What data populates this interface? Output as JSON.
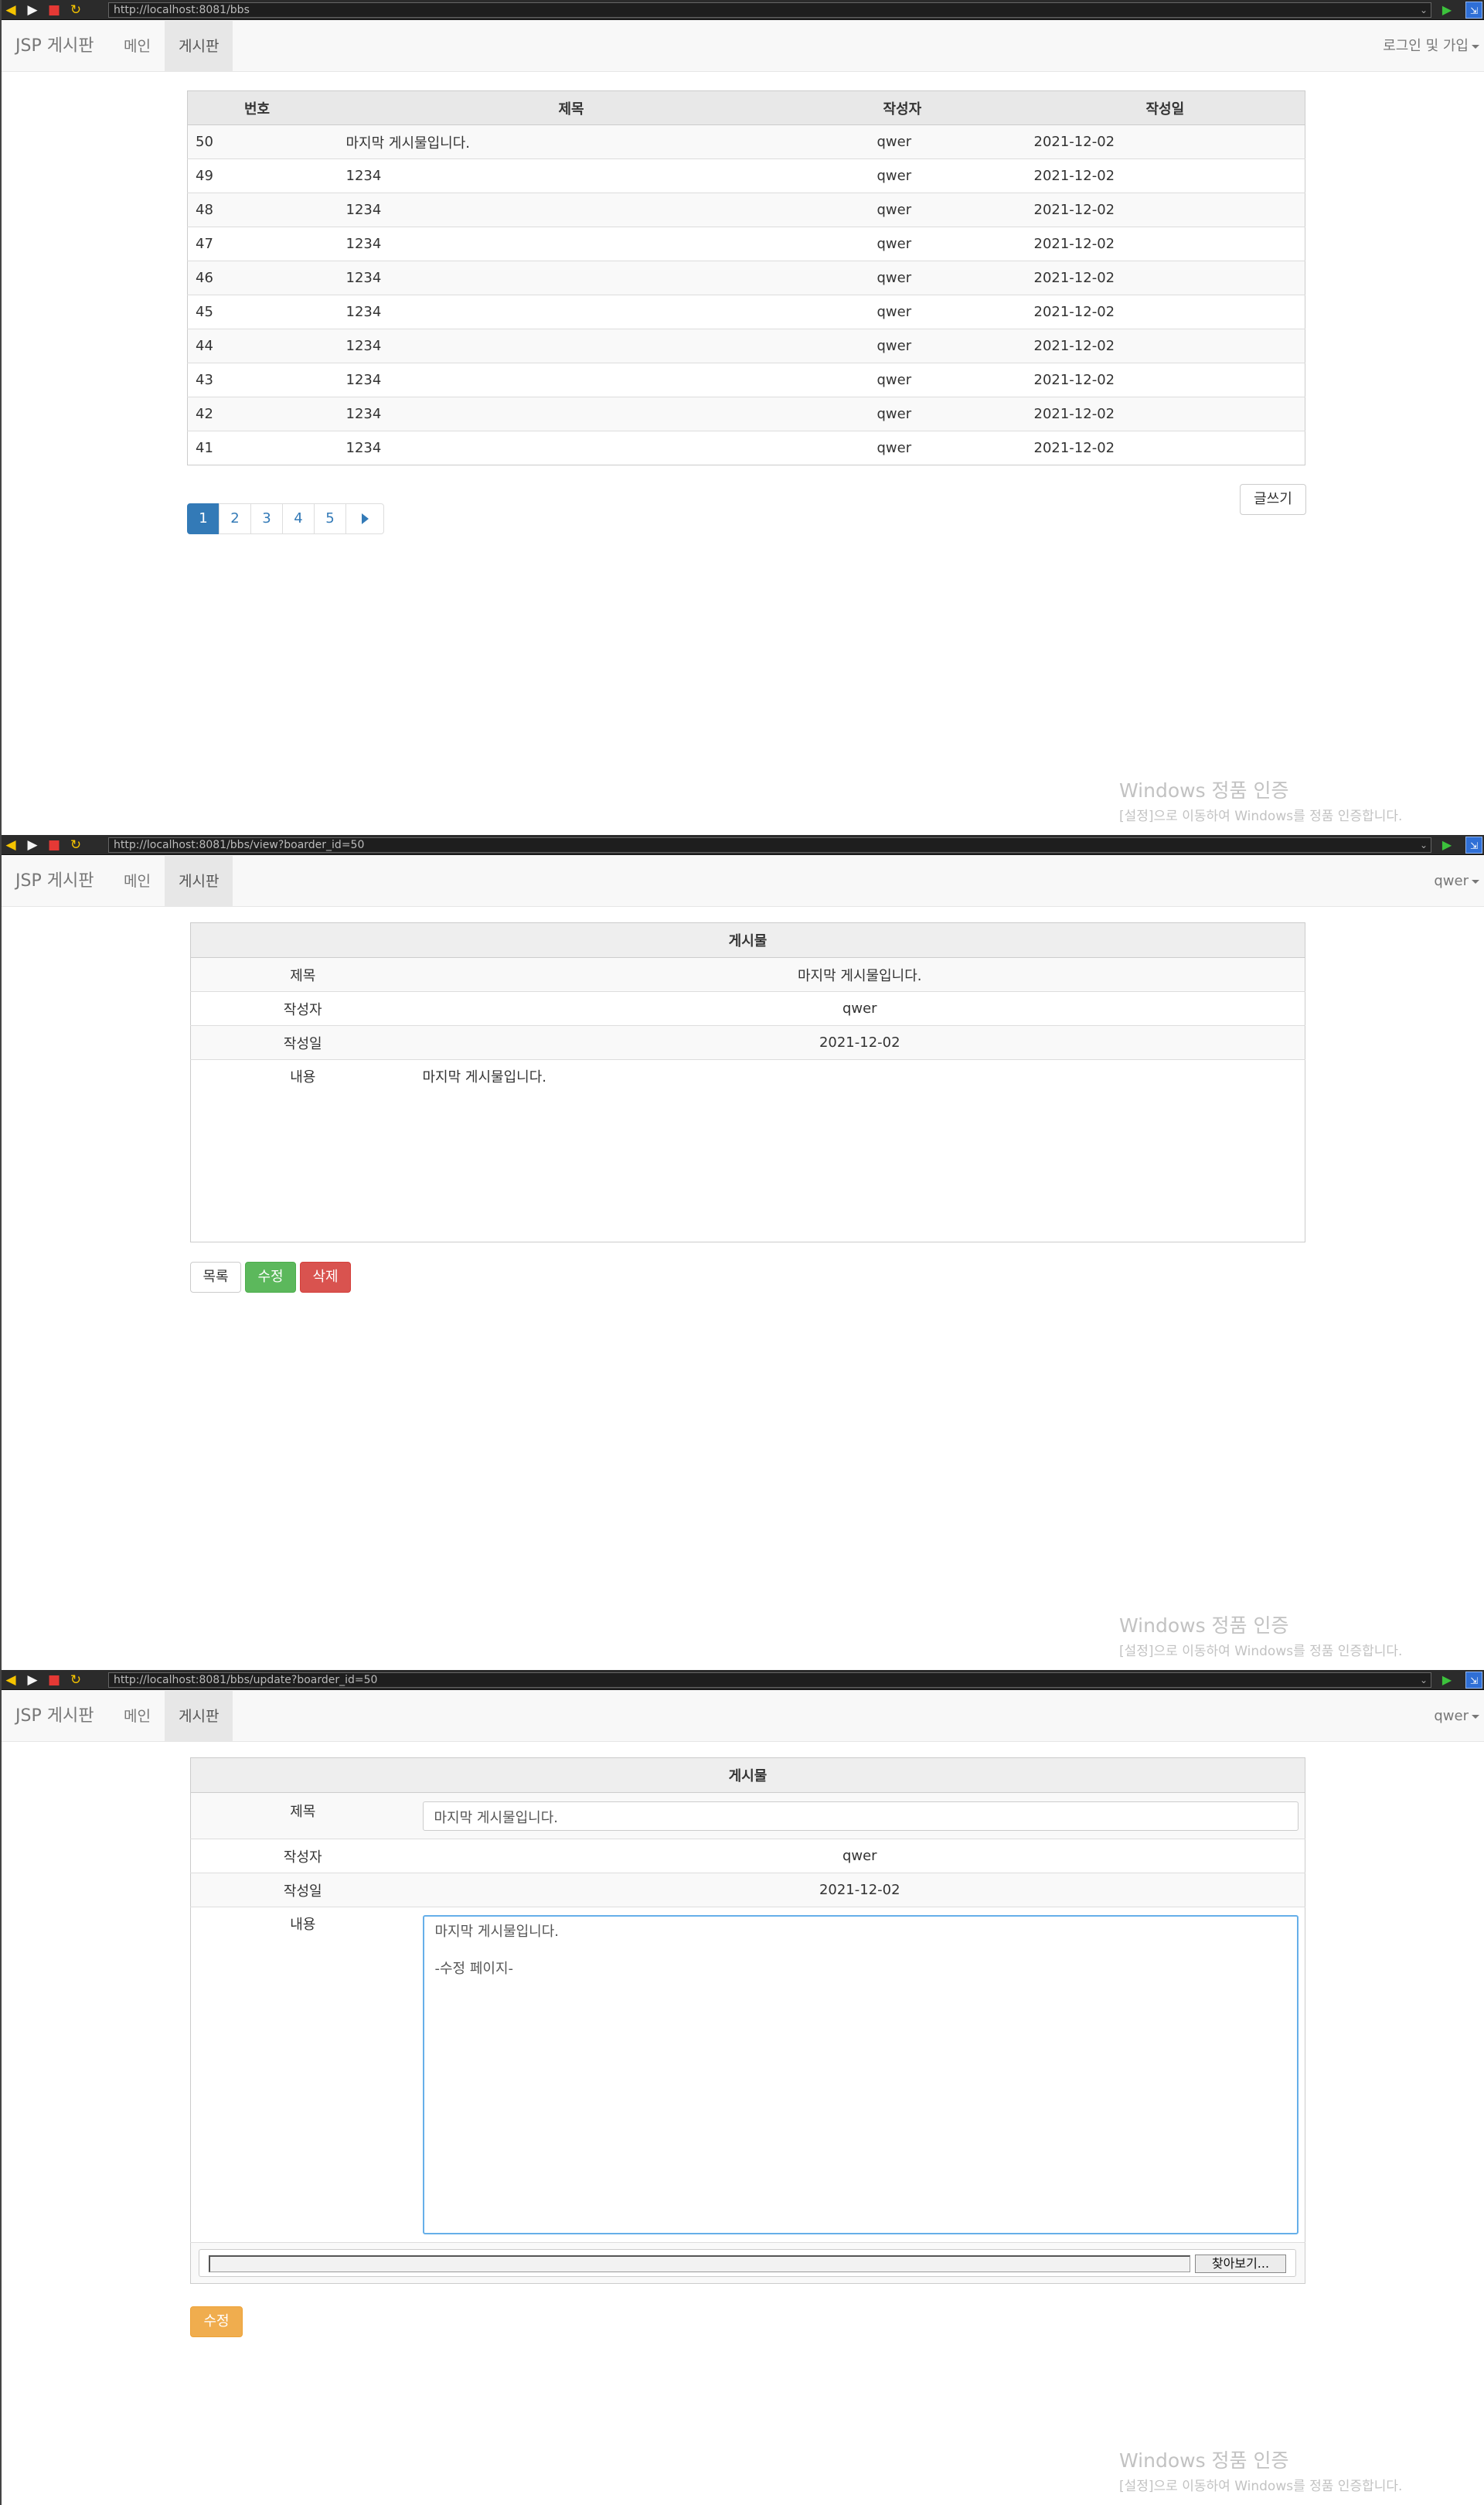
{
  "screen1": {
    "browser": {
      "url": "http://localhost:8081/bbs"
    },
    "navbar": {
      "brand": "JSP 게시판",
      "main": "메인",
      "bbs": "게시판",
      "right": "로그인 및 가입"
    },
    "table": {
      "headers": [
        "번호",
        "제목",
        "작성자",
        "작성일"
      ],
      "rows": [
        [
          "50",
          "마지막 게시물입니다.",
          "qwer",
          "2021-12-02"
        ],
        [
          "49",
          "1234",
          "qwer",
          "2021-12-02"
        ],
        [
          "48",
          "1234",
          "qwer",
          "2021-12-02"
        ],
        [
          "47",
          "1234",
          "qwer",
          "2021-12-02"
        ],
        [
          "46",
          "1234",
          "qwer",
          "2021-12-02"
        ],
        [
          "45",
          "1234",
          "qwer",
          "2021-12-02"
        ],
        [
          "44",
          "1234",
          "qwer",
          "2021-12-02"
        ],
        [
          "43",
          "1234",
          "qwer",
          "2021-12-02"
        ],
        [
          "42",
          "1234",
          "qwer",
          "2021-12-02"
        ],
        [
          "41",
          "1234",
          "qwer",
          "2021-12-02"
        ]
      ]
    },
    "pagination": {
      "pages": [
        "1",
        "2",
        "3",
        "4",
        "5"
      ],
      "active": "1",
      "next_icon": "chevron-right-icon"
    },
    "write_button": "글쓰기"
  },
  "screen2": {
    "browser": {
      "url": "http://localhost:8081/bbs/view?boarder_id=50"
    },
    "navbar": {
      "brand": "JSP 게시판",
      "main": "메인",
      "bbs": "게시판",
      "right": "qwer"
    },
    "table": {
      "header": "게시물",
      "title_label": "제목",
      "title_value": "마지막 게시물입니다.",
      "author_label": "작성자",
      "author_value": "qwer",
      "date_label": "작성일",
      "date_value": "2021-12-02",
      "content_label": "내용",
      "content_value": "마지막 게시물입니다."
    },
    "buttons": {
      "list": "목록",
      "edit": "수정",
      "delete": "삭제"
    }
  },
  "screen3": {
    "browser": {
      "url": "http://localhost:8081/bbs/update?boarder_id=50"
    },
    "navbar": {
      "brand": "JSP 게시판",
      "main": "메인",
      "bbs": "게시판",
      "right": "qwer"
    },
    "table": {
      "header": "게시물",
      "title_label": "제목",
      "title_value": "마지막 게시물입니다.",
      "author_label": "작성자",
      "author_value": "qwer",
      "date_label": "작성일",
      "date_value": "2021-12-02",
      "content_label": "내용",
      "content_value": "마지막 게시물입니다.\n\n-수정 페이지-"
    },
    "file_button": "찾아보기...",
    "submit_button": "수정"
  },
  "watermark": {
    "title": "Windows 정품 인증",
    "subtitle": "[설정]으로 이동하여 Windows를 정품 인증합니다."
  },
  "colors": {
    "primary": "#337ab7",
    "success": "#5cb85c",
    "danger": "#d9534f",
    "warning": "#f0ad4e"
  }
}
